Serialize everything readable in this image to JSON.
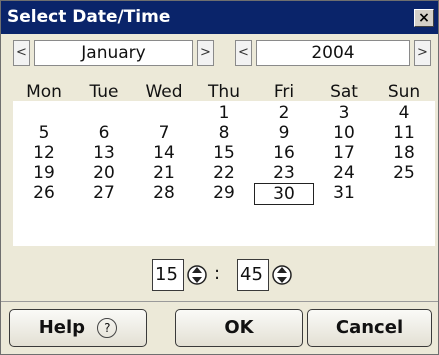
{
  "window": {
    "title": "Select Date/Time",
    "close_label": "×"
  },
  "nav": {
    "prev_month_label": "<",
    "month": "January",
    "next_month_label": ">",
    "prev_year_label": "<",
    "year": "2004",
    "next_year_label": ">"
  },
  "calendar": {
    "weekdays": [
      "Mon",
      "Tue",
      "Wed",
      "Thu",
      "Fri",
      "Sat",
      "Sun"
    ],
    "weeks": [
      [
        "",
        "",
        "",
        "1",
        "2",
        "3",
        "4"
      ],
      [
        "5",
        "6",
        "7",
        "8",
        "9",
        "10",
        "11"
      ],
      [
        "12",
        "13",
        "14",
        "15",
        "16",
        "17",
        "18"
      ],
      [
        "19",
        "20",
        "21",
        "22",
        "23",
        "24",
        "25"
      ],
      [
        "26",
        "27",
        "28",
        "29",
        "30",
        "31",
        ""
      ]
    ],
    "selected_day": "30"
  },
  "time": {
    "hour": "15",
    "colon": ":",
    "minute": "45"
  },
  "buttons": {
    "help_label": "Help",
    "help_icon": "?",
    "ok_label": "OK",
    "cancel_label": "Cancel"
  },
  "colors": {
    "titlebar": "#0a246a",
    "background": "#ece9d8",
    "calendar_bg": "#ffffff"
  }
}
